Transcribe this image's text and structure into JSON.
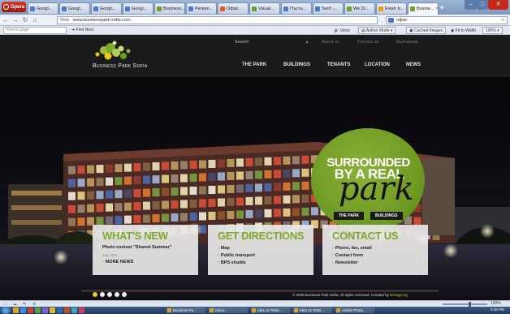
{
  "browser": {
    "menu_label": "Opera",
    "tabs": [
      {
        "label": "Googl...",
        "color": "#4a7ac9"
      },
      {
        "label": "Googl...",
        "color": "#4a7ac9"
      },
      {
        "label": "Googl...",
        "color": "#4a7ac9"
      },
      {
        "label": "Googl...",
        "color": "#4a7ac9"
      },
      {
        "label": "Business...",
        "color": "#6aa132"
      },
      {
        "label": "Perpen...",
        "color": "#4a7ac9"
      },
      {
        "label": "Офис...",
        "color": "#e05b2a"
      },
      {
        "label": "Visual...",
        "color": "#6aa132"
      },
      {
        "label": "Пъстъ...",
        "color": "#4a7ac9"
      },
      {
        "label": "Serif -...",
        "color": "#4a7ac9"
      },
      {
        "label": "We Di...",
        "color": "#6aa132"
      },
      {
        "label": "Fresh b...",
        "color": "#e0a020"
      },
      {
        "label": "Busine...",
        "color": "#6aa132",
        "active": true
      }
    ],
    "address": {
      "prefix": "Web",
      "url": "www.businesspark-sofia.com"
    },
    "search": {
      "value": "офис"
    },
    "find": {
      "placeholder": "Find in page",
      "next_label": "Find Next"
    },
    "toolbar": {
      "voice_label": "Voice",
      "author_mode_label": "Author Mode",
      "cached_images_label": "Cached Images",
      "fit_width_label": "Fit to Width",
      "zoom_label": "100%"
    }
  },
  "site": {
    "header": {
      "search_placeholder": "Search",
      "top_links": [
        "About us",
        "Contact us",
        "Български"
      ],
      "logo_text": "Business Park Sofia",
      "nav": [
        "THE PARK",
        "BUILDINGS",
        "TENANTS",
        "LOCATION",
        "NEWS"
      ]
    },
    "hero": {
      "line1": "SURROUNDED",
      "line2": "BY A REAL",
      "line3": "park",
      "buttons": [
        "THE PARK",
        "BUILDINGS"
      ]
    },
    "panels": {
      "whats_new": {
        "title": "WHAT'S NEW",
        "item": "Photo contest \"Shared Summer\"",
        "date": "July 2011",
        "more": "MORE NEWS"
      },
      "directions": {
        "title": "GET DIRECTIONS",
        "links": [
          "Map",
          "Public transport",
          "BPS shuttle"
        ]
      },
      "contact": {
        "title": "CONTACT US",
        "links": [
          "Phone, fax, email",
          "Contact form",
          "Newsletter"
        ]
      }
    },
    "slider_dots": 5,
    "slider_active": 0,
    "footer": {
      "copyright": "© 2009 Business Park Sofia. All rights reserved. Created by",
      "credit": "Netage.bg"
    }
  },
  "statusbar": {
    "zoom": "100%"
  },
  "taskbar": {
    "tasks": [
      "Business Pa...",
      "Inbox...",
      "Idea za Tekst...",
      "Idea za Tekst...",
      "Adobe Photo..."
    ],
    "clock": "5:45 PM"
  },
  "colors": {
    "accent_green": "#7cab2a",
    "browser_red": "#c8281a",
    "dot_active": "#e8c81f"
  }
}
